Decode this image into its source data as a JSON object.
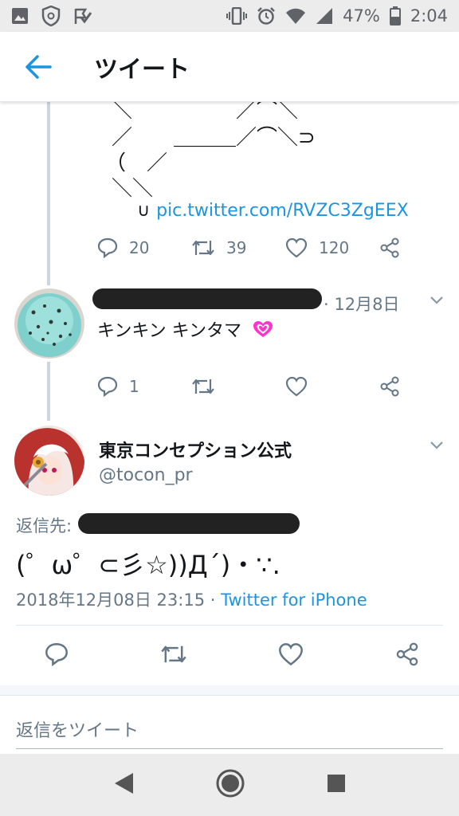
{
  "status_bar": {
    "battery": "47%",
    "time": "2:04",
    "left_icons": [
      "image-icon",
      "shield-icon",
      "check-flag-icon"
    ],
    "right_icons": [
      "vibrate-icon",
      "alarm-icon",
      "wifi-icon",
      "signal-icon",
      "battery-icon"
    ]
  },
  "header": {
    "title": "ツイート",
    "back_icon": "arrow-left-icon"
  },
  "previous_tweet": {
    "ascii_art_lines": [
      "＼　　　　　／⌒＼",
      "／　　＿＿＿／⌒＼⊃",
      "（　／",
      "＼＼"
    ],
    "pic_prefix": "∪",
    "pic_link": "pic.twitter.com/RVZC3ZgEEX",
    "replies": "20",
    "retweets": "39",
    "likes": "120"
  },
  "reply_tweet": {
    "date": "· 12月8日",
    "text": "キンキン キンタマ",
    "emoji": "💗",
    "replies": "1"
  },
  "main_tweet": {
    "name": "東京コンセプション公式",
    "handle": "@tocon_pr",
    "reply_to_label": "返信先:",
    "text": "(゜ω゜⊂彡☆))Д´)・∵.",
    "timestamp": "2018年12月08日 23:15 ·",
    "via": "Twitter for iPhone"
  },
  "reply_box": {
    "placeholder": "返信をツイート"
  },
  "colors": {
    "accent": "#1b95e0",
    "muted": "#657786",
    "heart_pink": "#ff33cc"
  }
}
